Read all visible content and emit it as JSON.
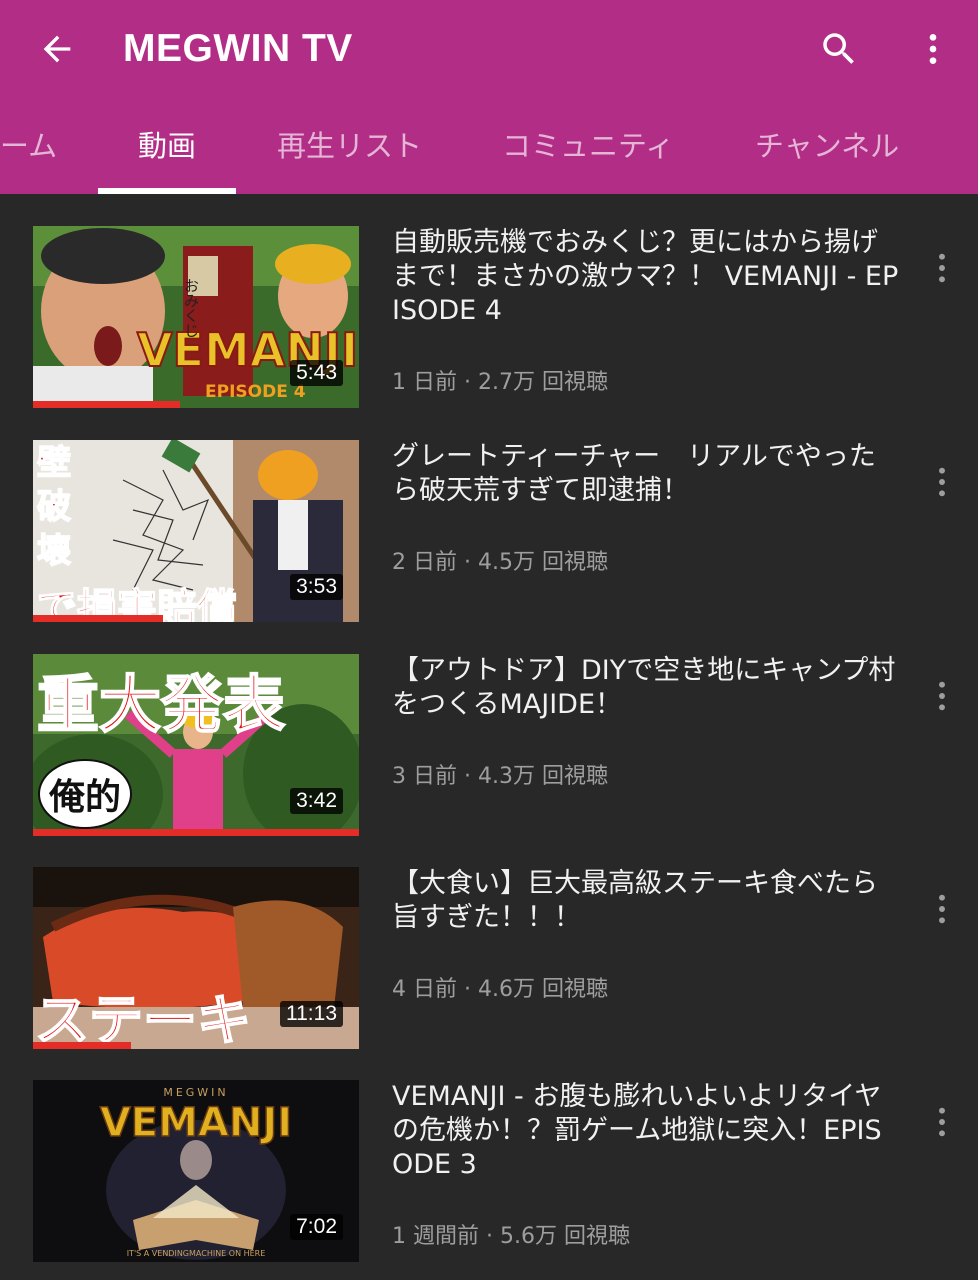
{
  "appbar": {
    "title": "MEGWIN TV",
    "color": "#b22d86",
    "back_icon": "arrow-left-icon",
    "search_icon": "search-icon",
    "more_icon": "more-vert-icon"
  },
  "tabs": [
    {
      "label": "ーム"
    },
    {
      "label": "動画",
      "active": true
    },
    {
      "label": "再生リスト"
    },
    {
      "label": "コミュニティ"
    },
    {
      "label": "チャンネル"
    }
  ],
  "videos": [
    {
      "title": "自動販売機でおみくじ？更にはから揚げまで！まさかの激ウマ？！ VEMANJI - EPISODE 4",
      "meta": "1 日前 · 2.7万 回視聴",
      "duration": "5:43",
      "thumb_text": [
        "VEMANJI",
        "EPISODE 4",
        "おみくじ"
      ],
      "watched_fraction": 0.45
    },
    {
      "title": "グレートティーチャー　リアルでやったら破天荒すぎて即逮捕！",
      "meta": "2 日前 · 4.5万 回視聴",
      "duration": "3:53",
      "thumb_text": [
        "壁",
        "破",
        "壊",
        "で損害賠償"
      ],
      "watched_fraction": 0.4
    },
    {
      "title": "【アウトドア】DIYで空き地にキャンプ村をつくるMAJIDE！",
      "meta": "3 日前 · 4.3万 回視聴",
      "duration": "3:42",
      "thumb_text": [
        "重大発表",
        "俺的"
      ],
      "watched_fraction": 1.0
    },
    {
      "title": "【大食い】巨大最高級ステーキ食べたら旨すぎた！！！",
      "meta": "4 日前 · 4.6万 回視聴",
      "duration": "11:13",
      "thumb_text": [
        "ステーキ"
      ],
      "watched_fraction": 0.3
    },
    {
      "title": "VEMANJI - お腹も膨れいよいよリタイヤの危機か！？罰ゲーム地獄に突入！EPISODE 3",
      "meta": "1 週間前 · 5.6万 回視聴",
      "duration": "7:02",
      "thumb_text": [
        "MEGWIN",
        "VEMANJI",
        "IT'S A VENDINGMACHINE ON HERE"
      ],
      "watched_fraction": 0
    }
  ]
}
